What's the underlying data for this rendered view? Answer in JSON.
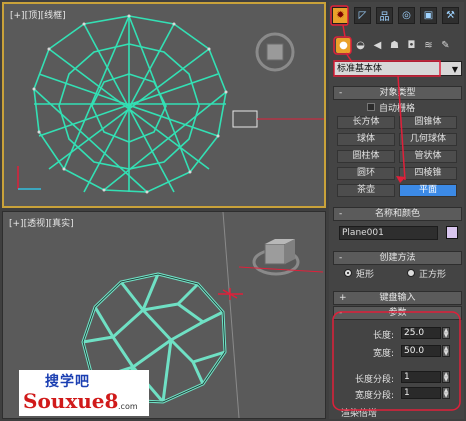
{
  "viewports": {
    "top": {
      "label": "[+][顶][线框]"
    },
    "perspective": {
      "label": "[+][透视][真实]"
    }
  },
  "command_panel": {
    "tabs": [
      "create-icon",
      "modify-icon",
      "hierarchy-icon",
      "motion-icon",
      "display-icon",
      "utilities-icon"
    ],
    "subcategories": [
      "geometry-icon",
      "shapes-icon",
      "lights-icon",
      "cameras-icon",
      "helpers-icon",
      "spacewarps-icon",
      "systems-icon"
    ],
    "category_dropdown": {
      "value": "标准基本体"
    },
    "object_type": {
      "title": "对象类型",
      "autogrid_label": "自动栅格",
      "buttons": [
        "长方体",
        "圆锥体",
        "球体",
        "几何球体",
        "圆柱体",
        "管状体",
        "圆环",
        "四棱锥",
        "茶壶",
        "平面"
      ],
      "active": "平面"
    },
    "name_color": {
      "title": "名称和颜色",
      "name_value": "Plane001",
      "color": "#d9c6ef"
    },
    "creation_method": {
      "title": "创建方法",
      "option1": "矩形",
      "option2": "正方形"
    },
    "keyboard_entry": {
      "title": "键盘输入"
    },
    "parameters": {
      "title": "参数",
      "length_label": "长度:",
      "length_value": "25.0",
      "width_label": "宽度:",
      "width_value": "50.0",
      "length_segs_label": "长度分段:",
      "length_segs_value": "1",
      "width_segs_label": "宽度分段:",
      "width_segs_value": "1"
    },
    "render_multipliers": {
      "title": "渲染倍增"
    }
  },
  "watermark": {
    "line1": "搜学吧",
    "line2": "Souxue8",
    "suffix": ".com"
  },
  "colors": {
    "wire": "#33e0b4",
    "highlight": "#e0203a",
    "active": "#3c8ae6",
    "active_tab": "#e9a12a"
  }
}
